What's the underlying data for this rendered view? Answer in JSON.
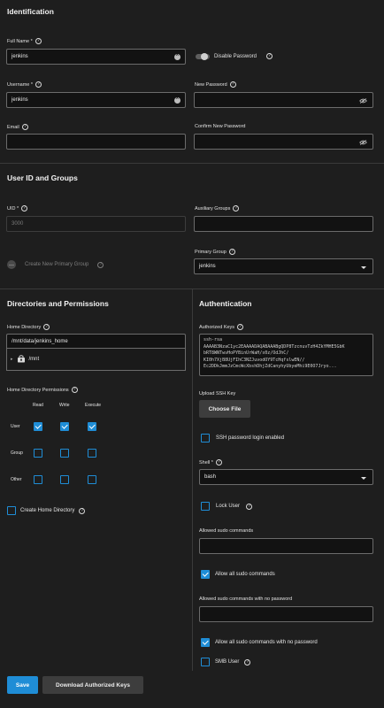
{
  "identification": {
    "title": "Identification",
    "full_name": {
      "label": "Full Name *",
      "value": "jenkins"
    },
    "disable_password": {
      "label": "Disable Password"
    },
    "username": {
      "label": "Username *",
      "value": "jenkins"
    },
    "new_password": {
      "label": "New Password",
      "value": ""
    },
    "email": {
      "label": "Email",
      "value": ""
    },
    "confirm_password": {
      "label": "Confirm New Password",
      "value": ""
    }
  },
  "uid_groups": {
    "title": "User ID and Groups",
    "uid": {
      "label": "UID *",
      "value": "3000"
    },
    "auxiliary_groups": {
      "label": "Auxiliary Groups",
      "value": ""
    },
    "create_primary_group": {
      "label": "Create New Primary Group"
    },
    "primary_group": {
      "label": "Primary Group",
      "value": "jenkins"
    }
  },
  "directories": {
    "title": "Directories and Permissions",
    "home_directory": {
      "label": "Home Directory",
      "value": "/mnt/data/jenkins_home"
    },
    "tree_root": "/mnt",
    "permissions": {
      "label": "Home Directory Permissions",
      "columns": [
        "Read",
        "Write",
        "Execute"
      ],
      "rows": [
        {
          "name": "User",
          "values": [
            true,
            true,
            true
          ]
        },
        {
          "name": "Group",
          "values": [
            false,
            false,
            false
          ]
        },
        {
          "name": "Other",
          "values": [
            false,
            false,
            false
          ]
        }
      ]
    },
    "create_home_directory": {
      "label": "Create Home Directory",
      "checked": false
    }
  },
  "authentication": {
    "title": "Authentication",
    "authorized_keys": {
      "label": "Authorized Keys",
      "lines": [
        "ssh-rsa",
        "AAAAB3NzaC1yc2EAAAADAQABAAABgQDP8TzcnuvTzH4ZkYMHE5GbK",
        "bRT8WNTwvHoPYBinUrWaH/s0z/OdJhC/",
        "KI0h7XjB8UjFIhC3NZJuvodOY9TcHqfslwEN//",
        "Ec2DDkJmmJzCmcWcXbshDhjZdCanyhyUbyeMhi9E0O7Jryo..."
      ]
    },
    "upload_ssh_key": {
      "label": "Upload SSH Key",
      "button": "Choose File"
    },
    "ssh_password_login": {
      "label": "SSH password login enabled",
      "checked": false
    },
    "shell": {
      "label": "Shell *",
      "value": "bash"
    },
    "lock_user": {
      "label": "Lock User",
      "checked": false
    },
    "allowed_sudo": {
      "label": "Allowed sudo commands",
      "value": ""
    },
    "allow_all_sudo": {
      "label": "Allow all sudo commands",
      "checked": true
    },
    "allowed_sudo_nopass": {
      "label": "Allowed sudo commands with no password",
      "value": ""
    },
    "allow_all_sudo_nopass": {
      "label": "Allow all sudo commands with no password",
      "checked": true
    },
    "smb_user": {
      "label": "SMB User",
      "checked": false
    }
  },
  "actions": {
    "save": "Save",
    "download_keys": "Download Authorized Keys"
  },
  "colors": {
    "accent": "#1f8dd6",
    "background": "#1e1e1e"
  }
}
